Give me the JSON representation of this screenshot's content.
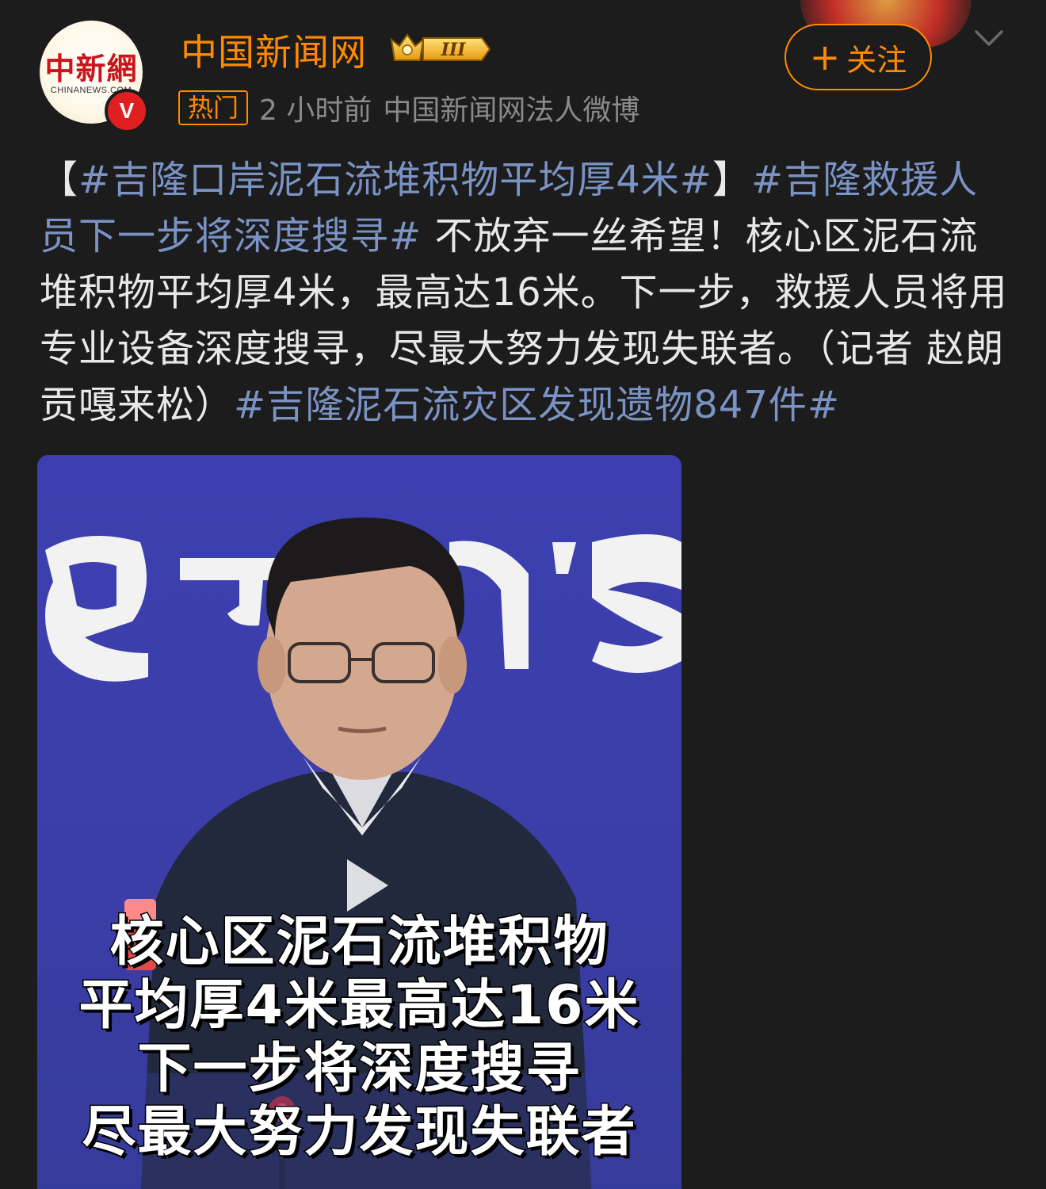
{
  "header": {
    "avatar_logo_cn": "中新網",
    "avatar_logo_en": "CHINANEWS.COM",
    "verified_mark": "V",
    "username": "中国新闻网",
    "level_badge": "III",
    "hot_tag": "热门",
    "time": "2 小时前",
    "source": "中国新闻网法人微博",
    "follow_label": "关注",
    "follow_plus": "+"
  },
  "post": {
    "open_bracket": "【",
    "tag1": "#吉隆口岸泥石流堆积物平均厚4米#",
    "close_bracket": "】",
    "tag2": "#吉隆救援人员下一步将深度搜寻#",
    "body": " 不放弃一丝希望！核心区泥石流堆积物平均厚4米，最高达16米。下一步，救援人员将用专业设备深度搜寻，尽最大努力发现失联者。（记者 赵朗 贡嘎来松）",
    "tag3": "#吉隆泥石流灾区发现遗物847件#"
  },
  "video": {
    "caption_lines": [
      "核心区泥石流堆积物",
      "平均厚4米最高达16米",
      "下一步将深度搜寻",
      "尽最大努力发现失联者"
    ]
  },
  "colors": {
    "accent_orange": "#ff8a00",
    "topic_blue": "#7a93c4",
    "background": "#1c1c1c",
    "verified_red": "#e02020"
  },
  "icons": [
    "crown-icon",
    "chevron-down-icon",
    "play-icon",
    "verified-icon"
  ]
}
